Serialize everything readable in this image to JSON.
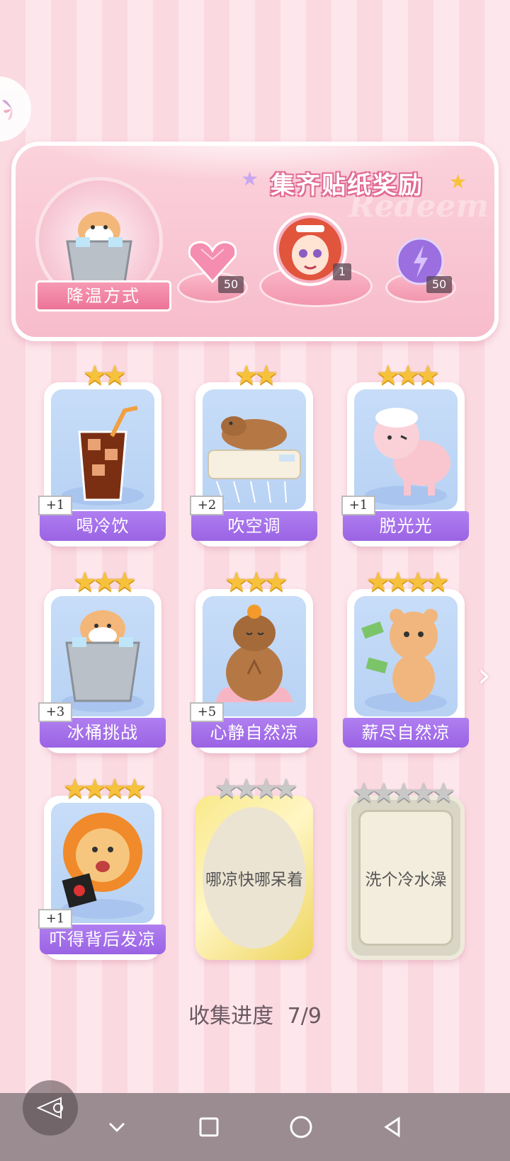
{
  "banner": {
    "title": "集齐贴纸奖励",
    "watermark": "Redeem",
    "method_label": "降温方式",
    "rewards": [
      {
        "icon": "pink-heart-gem-icon",
        "count": "50"
      },
      {
        "icon": "avatar-girl-icon",
        "count": "1"
      },
      {
        "icon": "purple-lightning-orb-icon",
        "count": "50"
      }
    ]
  },
  "stickers": [
    {
      "label": "喝冷饮",
      "bonus": "+1",
      "stars": 2,
      "icon": "iced-cola-icon",
      "collected": true
    },
    {
      "label": "吹空调",
      "bonus": "+2",
      "stars": 2,
      "icon": "capybara-ac-icon",
      "collected": true
    },
    {
      "label": "脱光光",
      "bonus": "+1",
      "stars": 3,
      "icon": "sheared-sheep-icon",
      "collected": true
    },
    {
      "label": "冰桶挑战",
      "bonus": "+3",
      "stars": 3,
      "icon": "hamster-ice-bucket-icon",
      "collected": true
    },
    {
      "label": "心静自然凉",
      "bonus": "+5",
      "stars": 3,
      "icon": "meditating-capybara-icon",
      "collected": true
    },
    {
      "label": "薪尽自然凉",
      "bonus": "",
      "stars": 4,
      "icon": "crying-bear-money-icon",
      "collected": true
    },
    {
      "label": "吓得背后发凉",
      "bonus": "+1",
      "stars": 4,
      "icon": "scared-lion-icon",
      "collected": true
    },
    {
      "label": "哪凉快哪呆着",
      "bonus": "",
      "stars": 4,
      "icon": "locked-gold-card-icon",
      "collected": false
    },
    {
      "label": "洗个冷水澡",
      "bonus": "",
      "stars": 5,
      "icon": "locked-grey-card-icon",
      "collected": false
    }
  ],
  "progress": {
    "label": "收集进度",
    "value": "7/9"
  }
}
